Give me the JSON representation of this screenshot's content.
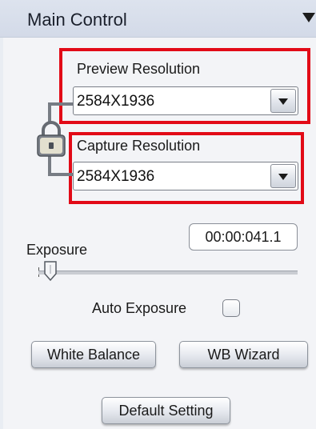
{
  "header": {
    "title": "Main Control",
    "collapse_icon": "triangle-down-icon"
  },
  "preview": {
    "label": "Preview Resolution",
    "value": "2584X1936"
  },
  "capture": {
    "label": "Capture Resolution",
    "value": "2584X1936"
  },
  "lock": {
    "icon": "lock-icon"
  },
  "exposure": {
    "label": "Exposure",
    "time": "00:00:041.1",
    "slider_level": 0.02
  },
  "auto_exposure": {
    "label": "Auto Exposure",
    "checked": false
  },
  "buttons": {
    "white_balance": "White Balance",
    "wb_wizard": "WB Wizard",
    "default_setting": "Default Setting"
  },
  "colors": {
    "highlight": "#e20a17",
    "header_bg": "#d7dde9",
    "panel_bg": "#f3f4f7"
  }
}
